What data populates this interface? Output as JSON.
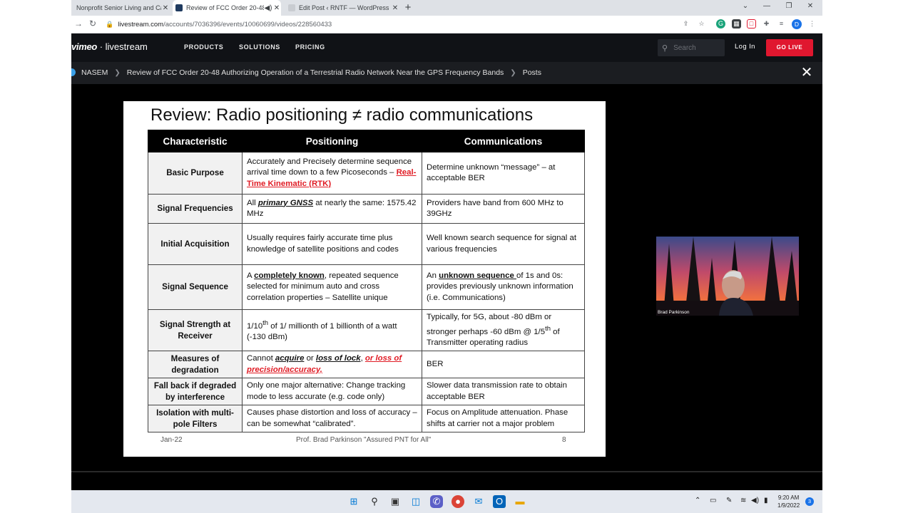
{
  "browser": {
    "tabs": [
      {
        "title": "Nonprofit Senior Living and Care",
        "favicon_color": "#5f6368"
      },
      {
        "title": "Review of FCC Order 20-48 A",
        "favicon_color": "#1f3a5f"
      },
      {
        "title": "Edit Post ‹ RNTF — WordPress",
        "favicon_color": "#9aa0a6"
      }
    ],
    "new_tab": "+",
    "window_controls": {
      "minimize": "⌄",
      "restore": "—",
      "maximize": "❐",
      "close": "✕"
    },
    "url": {
      "host": "livestream.com",
      "path": "/accounts/7036396/events/10060699/videos/228560433"
    },
    "profile_initial": "D"
  },
  "site": {
    "logo_brand": "vimeo",
    "logo_product": "livestream",
    "nav": [
      "PRODUCTS",
      "SOLUTIONS",
      "PRICING"
    ],
    "search_placeholder": "Search",
    "login": "Log In",
    "go_live": "GO LIVE"
  },
  "breadcrumb": {
    "items": [
      "NASEM",
      "Review of FCC Order 20-48 Authorizing Operation of a Terrestrial Radio Network Near the GPS Frequency Bands",
      "Posts"
    ]
  },
  "slide": {
    "title": "Review: Radio positioning  ≠ radio communications",
    "headers": [
      "Characteristic",
      "Positioning",
      "Communications"
    ],
    "rows": [
      {
        "characteristic": "Basic Purpose",
        "positioning": {
          "text": "Accurately and Precisely determine sequence arrival time down to a few Picoseconds – ",
          "link": "Real-Time Kinematic (RTK)"
        },
        "communications": "Determine unknown “message” – at acceptable BER"
      },
      {
        "characteristic": "Signal Frequencies",
        "positioning": {
          "pre": "All ",
          "emph": "primary GNSS",
          "post": " at nearly the same: 1575.42 MHz"
        },
        "communications": "Providers have band from 600 MHz to 39GHz"
      },
      {
        "characteristic": "Initial Acquisition",
        "positioning": "Usually requires fairly accurate time plus knowledge of satellite positions and codes",
        "communications": "Well known search sequence for signal at various frequencies"
      },
      {
        "characteristic": "Signal Sequence",
        "positioning": {
          "pre": "A ",
          "emph": "completely known",
          "post": ", repeated sequence selected for minimum auto and cross correlation properties – Satellite unique"
        },
        "communications": {
          "pre": "An ",
          "emph": "unknown sequence ",
          "post": "of 1s and 0s: provides previously unknown information (i.e. Communications)"
        }
      },
      {
        "characteristic": "Signal Strength at Receiver",
        "positioning": {
          "a": "1/10",
          "sup1": "th",
          "b": " of 1/ millionth of 1 billionth of a watt (-130 dBm)"
        },
        "communications": {
          "a": "Typically, for 5G, about -80 dBm or stronger perhaps -60 dBm @ 1/5",
          "sup1": "th",
          "b": " of Transmitter operating radius"
        }
      },
      {
        "characteristic": "Measures of degradation",
        "positioning": {
          "pre": "Cannot ",
          "e1": "acquire",
          "m1": " or ",
          "e2": "loss of lock",
          "m2": ", ",
          "red": "or loss of precision/accuracy,"
        },
        "communications": "BER"
      },
      {
        "characteristic": "Fall back if degraded by interference",
        "positioning": "Only one major alternative: Change tracking mode to less accurate (e.g. code only)",
        "communications": "Slower data transmission rate to obtain acceptable BER"
      },
      {
        "characteristic": "Isolation with multi-pole Filters",
        "positioning": "Causes phase distortion and loss of accuracy – can be somewhat “calibrated”.",
        "communications": "Focus on Amplitude attenuation.  Phase shifts at carrier not a major problem"
      }
    ],
    "footer": {
      "date": "Jan-22",
      "presenter": "Prof. Brad Parkinson \"Assured PNT for All\"",
      "page": "8"
    }
  },
  "pip": {
    "name": "Brad Parkinson"
  },
  "taskbar": {
    "clock_time": "9:20 AM",
    "clock_date": "1/9/2022",
    "notifications": "3"
  }
}
